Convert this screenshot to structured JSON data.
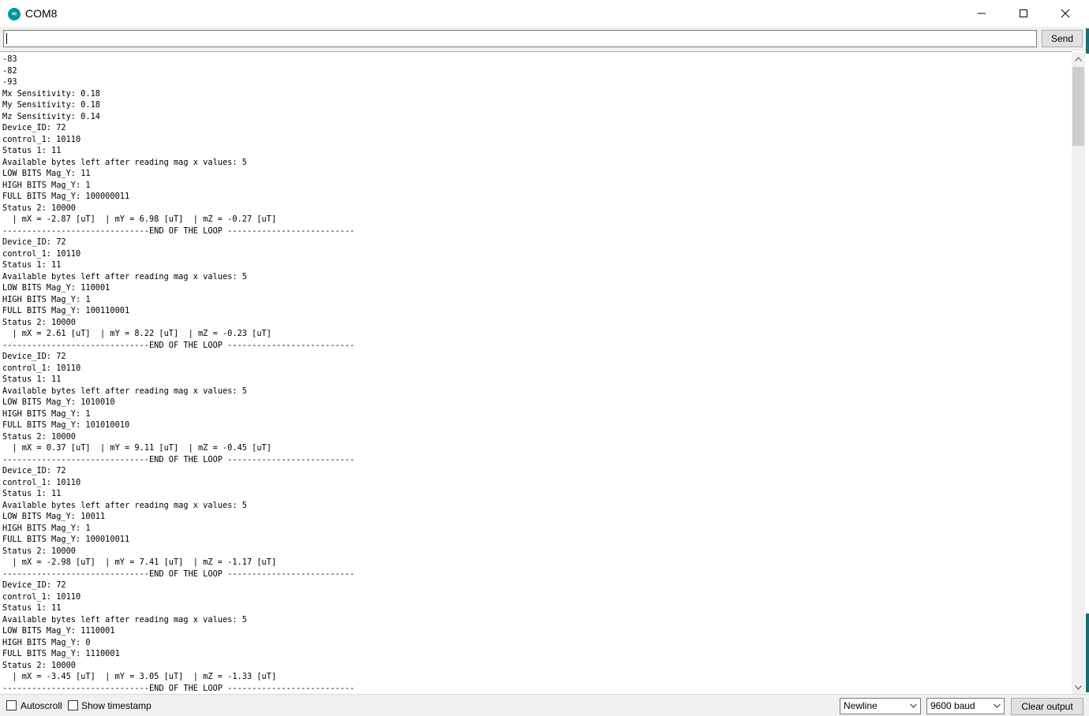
{
  "window": {
    "title": "COM8",
    "app_icon_text": "∞"
  },
  "send_row": {
    "input_value": "",
    "send_label": "Send"
  },
  "output": {
    "text": "-83\n-82\n-93\nMx Sensitivity: 0.18\nMy Sensitivity: 0.18\nMz Sensitivity: 0.14\nDevice_ID: 72\ncontrol_1: 10110\nStatus 1: 11\nAvailable bytes left after reading mag x values: 5\nLOW BITS Mag_Y: 11\nHIGH BITS Mag_Y: 1\nFULL BITS Mag_Y: 100000011\nStatus 2: 10000\n  | mX = -2.87 [uT]  | mY = 6.98 [uT]  | mZ = -0.27 [uT]\n------------------------------END OF THE LOOP --------------------------\nDevice_ID: 72\ncontrol_1: 10110\nStatus 1: 11\nAvailable bytes left after reading mag x values: 5\nLOW BITS Mag_Y: 110001\nHIGH BITS Mag_Y: 1\nFULL BITS Mag_Y: 100110001\nStatus 2: 10000\n  | mX = 2.61 [uT]  | mY = 8.22 [uT]  | mZ = -0.23 [uT]\n------------------------------END OF THE LOOP --------------------------\nDevice_ID: 72\ncontrol_1: 10110\nStatus 1: 11\nAvailable bytes left after reading mag x values: 5\nLOW BITS Mag_Y: 1010010\nHIGH BITS Mag_Y: 1\nFULL BITS Mag_Y: 101010010\nStatus 2: 10000\n  | mX = 0.37 [uT]  | mY = 9.11 [uT]  | mZ = -0.45 [uT]\n------------------------------END OF THE LOOP --------------------------\nDevice_ID: 72\ncontrol_1: 10110\nStatus 1: 11\nAvailable bytes left after reading mag x values: 5\nLOW BITS Mag_Y: 10011\nHIGH BITS Mag_Y: 1\nFULL BITS Mag_Y: 100010011\nStatus 2: 10000\n  | mX = -2.98 [uT]  | mY = 7.41 [uT]  | mZ = -1.17 [uT]\n------------------------------END OF THE LOOP --------------------------\nDevice_ID: 72\ncontrol_1: 10110\nStatus 1: 11\nAvailable bytes left after reading mag x values: 5\nLOW BITS Mag_Y: 1110001\nHIGH BITS Mag_Y: 0\nFULL BITS Mag_Y: 1110001\nStatus 2: 10000\n  | mX = -3.45 [uT]  | mY = 3.05 [uT]  | mZ = -1.33 [uT]\n------------------------------END OF THE LOOP --------------------------"
  },
  "bottom": {
    "autoscroll_label": "Autoscroll",
    "autoscroll_checked": false,
    "timestamp_label": "Show timestamp",
    "timestamp_checked": false,
    "line_ending": "Newline",
    "baud": "9600 baud",
    "clear_label": "Clear output"
  },
  "colors": {
    "accent": "#00979c",
    "chrome": "#f0f0f0",
    "button": "#e1e1e1"
  }
}
